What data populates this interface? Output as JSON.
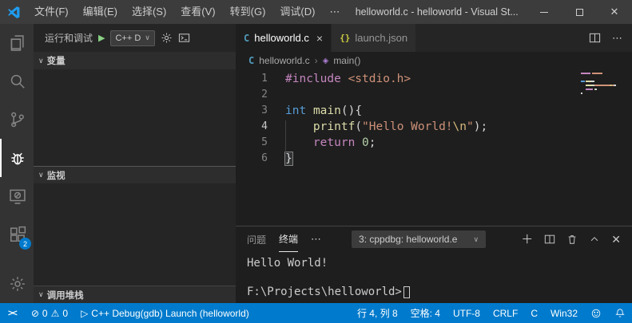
{
  "title_bar": {
    "menus": [
      "文件(F)",
      "编辑(E)",
      "选择(S)",
      "查看(V)",
      "转到(G)",
      "调试(D)"
    ],
    "menu_more": "⋯",
    "title": "helloworld.c - helloworld - Visual St..."
  },
  "icons": {
    "close_window": "✕",
    "chevron_down": "∨",
    "play": "▶",
    "debug_play": "▷",
    "tab_close": "×",
    "breadcrumb_separator": "›",
    "symbol_method": "◈",
    "error_circle": "⊘",
    "warning_triangle": "⚠",
    "remote": "><",
    "more": "⋯",
    "add": "＋"
  },
  "activity_bar": {
    "items": [
      "explorer",
      "search",
      "source-control",
      "run-and-debug",
      "remote-explorer",
      "extensions",
      "manage"
    ],
    "active_item": "run-and-debug",
    "extensions_badge": "2"
  },
  "sidebar": {
    "title": "运行和调试",
    "launch_config": "C++ D",
    "sections": {
      "variables": "变量",
      "watch": "监视",
      "call_stack": "调用堆栈"
    }
  },
  "editor": {
    "tabs": [
      {
        "icon": "C",
        "label": "helloworld.c"
      },
      {
        "icon": "{}",
        "label": "launch.json"
      }
    ],
    "breadcrumb": {
      "file": "helloworld.c",
      "symbol": "main()"
    },
    "code_lines": [
      {
        "num": "1",
        "tokens": [
          {
            "t": "#include",
            "c": "keyword"
          },
          {
            "t": " ",
            "c": "plain"
          },
          {
            "t": "<stdio.h>",
            "c": "string"
          }
        ]
      },
      {
        "num": "2",
        "tokens": []
      },
      {
        "num": "3",
        "tokens": [
          {
            "t": "int",
            "c": "type"
          },
          {
            "t": " ",
            "c": "plain"
          },
          {
            "t": "main",
            "c": "function"
          },
          {
            "t": "(){",
            "c": "plain"
          }
        ]
      },
      {
        "num": "4",
        "active": true,
        "tokens": [
          {
            "t": "    ",
            "c": "plain"
          },
          {
            "t": "printf",
            "c": "function"
          },
          {
            "t": "(",
            "c": "plain"
          },
          {
            "t": "\"Hello World!",
            "c": "string"
          },
          {
            "t": "\\n",
            "c": "escape"
          },
          {
            "t": "\"",
            "c": "string"
          },
          {
            "t": ");",
            "c": "plain"
          }
        ]
      },
      {
        "num": "5",
        "tokens": [
          {
            "t": "    ",
            "c": "plain"
          },
          {
            "t": "return",
            "c": "keyword"
          },
          {
            "t": " ",
            "c": "plain"
          },
          {
            "t": "0",
            "c": "number"
          },
          {
            "t": ";",
            "c": "plain"
          }
        ]
      },
      {
        "num": "6",
        "tokens": [
          {
            "t": "}",
            "c": "plain",
            "boxed": true
          }
        ]
      }
    ]
  },
  "panel": {
    "tabs": {
      "problems": "问题",
      "terminal": "终端"
    },
    "terminal_select": "3: cppdbg: helloworld.e",
    "terminal_lines": [
      "Hello World!",
      "",
      "F:\\Projects\\helloworld>"
    ]
  },
  "status_bar": {
    "errors": "0",
    "warnings": "0",
    "debug_launch": "C++ Debug(gdb) Launch (helloworld)",
    "line_col": "行 4, 列 8",
    "indent": "空格: 4",
    "encoding": "UTF-8",
    "eol": "CRLF",
    "language": "C",
    "config": "Win32"
  },
  "colors": {
    "status_bar": "#007acc",
    "title_bar": "#3c3c3c",
    "activity_bar": "#333333",
    "sidebar": "#252526",
    "editor_background": "#1e1e1e",
    "keyword": "#c586c0",
    "type": "#569cd6",
    "function": "#dcdcaa",
    "string": "#ce9178",
    "escape": "#d7ba7d",
    "number": "#b5cea8"
  }
}
